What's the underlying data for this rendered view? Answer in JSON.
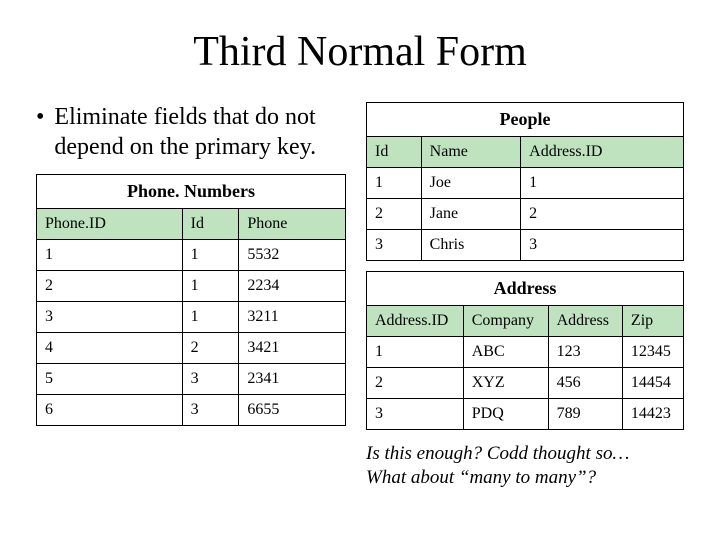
{
  "title": "Third Normal Form",
  "bullet": "Eliminate fields that do not depend on the primary key.",
  "phone_numbers": {
    "caption": "Phone. Numbers",
    "headers": [
      "Phone.ID",
      "Id",
      "Phone"
    ],
    "rows": [
      [
        "1",
        "1",
        "5532"
      ],
      [
        "2",
        "1",
        "2234"
      ],
      [
        "3",
        "1",
        "3211"
      ],
      [
        "4",
        "2",
        "3421"
      ],
      [
        "5",
        "3",
        "2341"
      ],
      [
        "6",
        "3",
        "6655"
      ]
    ]
  },
  "people": {
    "caption": "People",
    "headers": [
      "Id",
      "Name",
      "Address.ID"
    ],
    "rows": [
      [
        "1",
        "Joe",
        "1"
      ],
      [
        "2",
        "Jane",
        "2"
      ],
      [
        "3",
        "Chris",
        "3"
      ]
    ]
  },
  "address": {
    "caption": "Address",
    "headers": [
      "Address.ID",
      "Company",
      "Address",
      "Zip"
    ],
    "rows": [
      [
        "1",
        "ABC",
        "123",
        "12345"
      ],
      [
        "2",
        "XYZ",
        "456",
        "14454"
      ],
      [
        "3",
        "PDQ",
        "789",
        "14423"
      ]
    ]
  },
  "footnote_line1": "Is this enough?  Codd thought so…",
  "footnote_line2": "What about “many to many”?"
}
